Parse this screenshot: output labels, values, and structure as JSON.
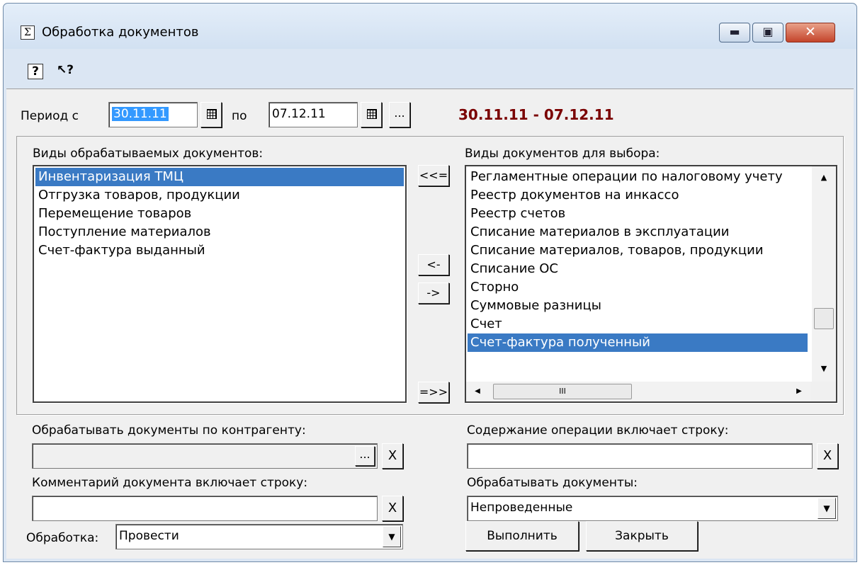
{
  "window": {
    "title": "Обработка документов",
    "app_icon_glyph": "Σ",
    "min_glyph": "▬",
    "max_glyph": "▣",
    "close_glyph": "✕"
  },
  "toolbar": {
    "help_glyph": "?",
    "context_help_glyph": "↖?"
  },
  "period": {
    "from_label": "Период с",
    "from_value": "30.11.11",
    "to_label": "по",
    "to_value": "07.12.11",
    "more_label": "...",
    "display": "30.11.11 - 07.12.11"
  },
  "processed_docs": {
    "label": "Виды обрабатываемых документов:",
    "items": [
      "Инвентаризация ТМЦ",
      "Отгрузка товаров, продукции",
      "Перемещение товаров",
      "Поступление материалов",
      "Счет-фактура выданный"
    ],
    "selected_index": 0
  },
  "transfer_buttons": {
    "add_all": "<<=",
    "add": "<-",
    "remove": "->",
    "remove_all": "=>>"
  },
  "available_docs": {
    "label": "Виды документов для выбора:",
    "items": [
      "Регламентные операции по налоговому учету",
      "Реестр документов на инкассо",
      "Реестр счетов",
      "Списание материалов в эксплуатации",
      "Списание материалов, товаров, продукции",
      "Списание ОС",
      "Сторно",
      "Суммовые разницы",
      "Счет",
      "Счет-фактура полученный"
    ],
    "selected_index": 9,
    "scroll_up": "▲",
    "scroll_down": "▼",
    "scroll_left": "◀",
    "scroll_right": "▶",
    "hthumb_grip": "III"
  },
  "contractor": {
    "label": "Обрабатывать документы по контрагенту:",
    "value": "",
    "select_label": "...",
    "clear_label": "X"
  },
  "operation_content": {
    "label": "Содержание операции включает строку:",
    "value": "",
    "clear_label": "X"
  },
  "comment": {
    "label": "Комментарий документа включает строку:",
    "value": "",
    "clear_label": "X"
  },
  "process_docs": {
    "label": "Обрабатывать документы:",
    "value": "Непроведенные",
    "arrow": "▼"
  },
  "processing": {
    "label": "Обработка:",
    "value": "Провести",
    "arrow": "▼"
  },
  "actions": {
    "execute": "Выполнить",
    "close": "Закрыть"
  }
}
